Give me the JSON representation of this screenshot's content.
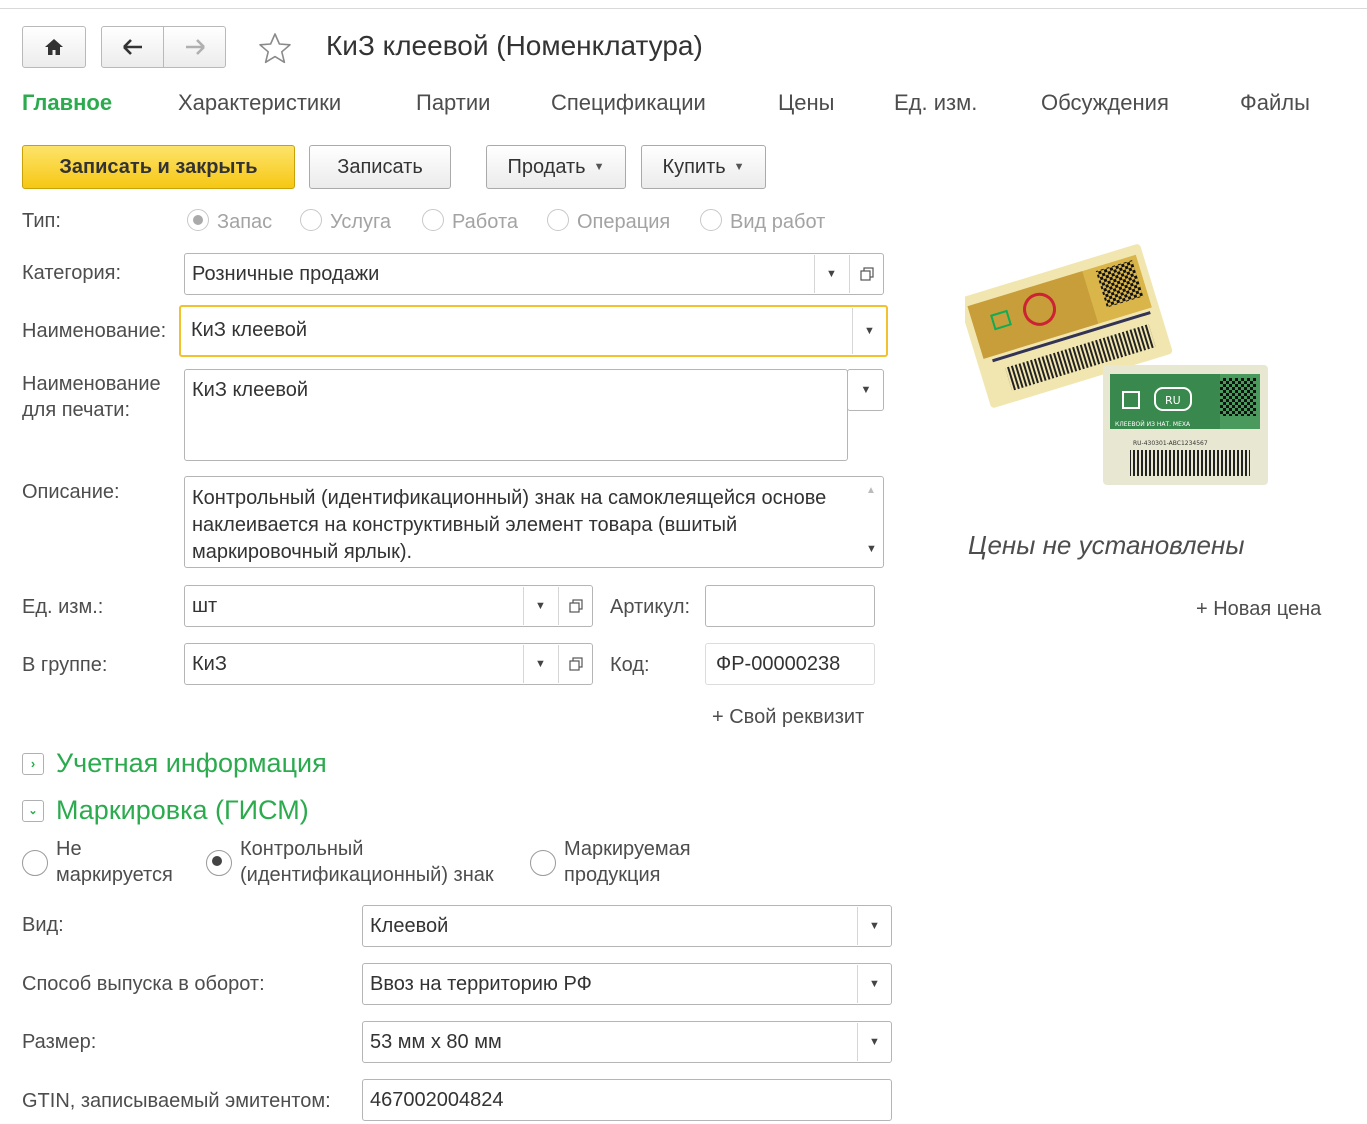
{
  "window": {
    "title": "КиЗ клеевой (Номенклатура)"
  },
  "tabs": [
    {
      "label": "Главное",
      "active": true
    },
    {
      "label": "Характеристики"
    },
    {
      "label": "Партии"
    },
    {
      "label": "Спецификации"
    },
    {
      "label": "Цены"
    },
    {
      "label": "Ед. изм."
    },
    {
      "label": "Обсуждения"
    },
    {
      "label": "Файлы"
    }
  ],
  "toolbar": {
    "save_close": "Записать и закрыть",
    "save": "Записать",
    "sell": "Продать",
    "buy": "Купить"
  },
  "form": {
    "type_label": "Тип:",
    "type_options": [
      "Запас",
      "Услуга",
      "Работа",
      "Операция",
      "Вид работ"
    ],
    "type_selected": "Запас",
    "category_label": "Категория:",
    "category_value": "Розничные продажи",
    "name_label": "Наименование:",
    "name_value": "КиЗ клеевой",
    "print_name_label": "Наименование для печати:",
    "print_name_value": "КиЗ клеевой",
    "description_label": "Описание:",
    "description_value": "Контрольный (идентификационный) знак на самоклеящейся основе наклеивается на конструктивный элемент товара (вшитый маркировочный ярлык).",
    "unit_label": "Ед. изм.:",
    "unit_value": "шт",
    "article_label": "Артикул:",
    "article_value": "",
    "group_label": "В группе:",
    "group_value": "КиЗ",
    "code_label": "Код:",
    "code_value": "ФР-00000238",
    "custom_attr_link": "+ Свой реквизит"
  },
  "sections": {
    "accounting": "Учетная информация",
    "marking": "Маркировка (ГИСМ)"
  },
  "marking": {
    "options": [
      "Не маркируется",
      "Контрольный (идентификационный) знак",
      "Маркируемая продукция"
    ],
    "selected": "Контрольный (идентификационный) знак",
    "kind_label": "Вид:",
    "kind_value": "Клеевой",
    "release_label": "Способ выпуска в оборот:",
    "release_value": "Ввоз на территорию РФ",
    "size_label": "Размер:",
    "size_value": "53 мм x 80 мм",
    "gtin_label": "GTIN, записываемый эмитентом:",
    "gtin_value": "467002004824"
  },
  "prices": {
    "none_text": "Цены не установлены",
    "new_price_link": "+ Новая цена"
  },
  "image": {
    "label_text": "КЛЕЕВОЙ ИЗ НАТ. МЕХА",
    "country_badge": "RU",
    "code_text": "RU-430301-ABC1234567"
  },
  "colors": {
    "accent_green": "#2bab4e",
    "primary_button": "#f6c814",
    "focus_border": "#f2c12e",
    "text": "#4d4d4d"
  },
  "icons": {
    "home": "home-icon",
    "back": "arrow-left-icon",
    "forward": "arrow-right-icon",
    "favorite": "star-icon",
    "dropdown": "chevron-down-icon",
    "open": "open-form-icon",
    "expand": "chevron-right-icon",
    "collapse": "chevron-down-icon"
  }
}
